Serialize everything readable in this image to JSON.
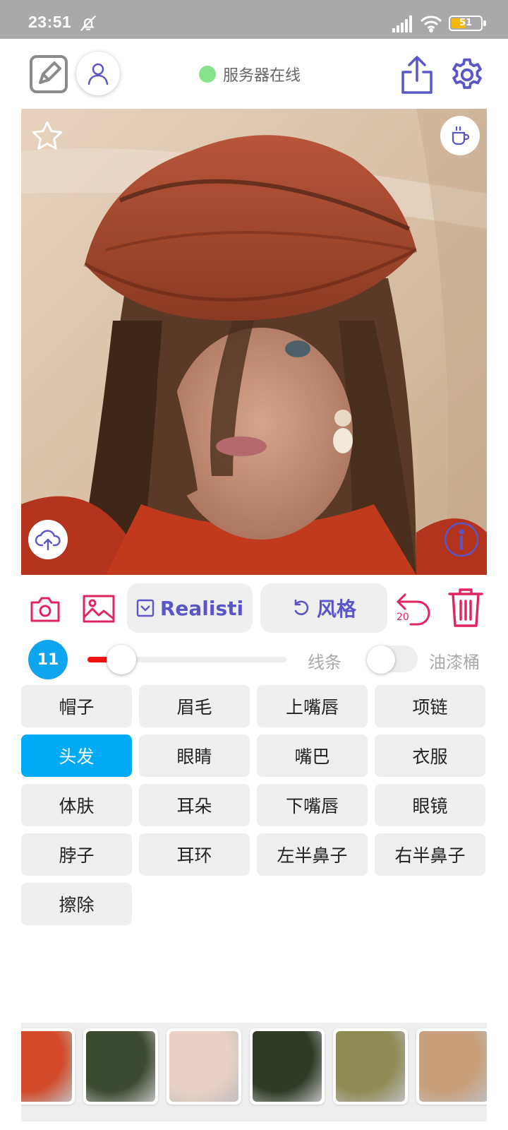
{
  "status_bar": {
    "time": "23:51",
    "battery": "51",
    "battery_level": 0.51,
    "icons": [
      "bell-off-icon",
      "signal-icon",
      "wifi-icon",
      "battery-icon"
    ]
  },
  "toolbar": {
    "server_status": "服务器在线",
    "server_status_color": "#86e38a",
    "icons": [
      "edit-icon",
      "user-icon",
      "share-icon",
      "settings-icon"
    ]
  },
  "canvas": {
    "icons": [
      "star-icon",
      "cup-icon",
      "cloud-upload-icon",
      "info-icon"
    ]
  },
  "actions": {
    "model_label": "Realisti",
    "style_label": "风格",
    "undo_count": "20",
    "accent_color": "#e0245e",
    "primary_color": "#5b56c8"
  },
  "brush": {
    "size": "11",
    "slider_level": 0.17,
    "lines_label": "线条",
    "bucket_label": "油漆桶",
    "bucket_enabled": false
  },
  "segments": {
    "active": "头发",
    "items": [
      "帽子",
      "眉毛",
      "上嘴唇",
      "项链",
      "头发",
      "眼睛",
      "嘴巴",
      "衣服",
      "体肤",
      "耳朵",
      "下嘴唇",
      "眼镜",
      "脖子",
      "耳环",
      "左半鼻子",
      "右半鼻子",
      "擦除"
    ]
  },
  "textures": [
    "#d24a2a",
    "#3d4a32",
    "#ead0c4",
    "#2e3a26",
    "#8e8b56",
    "#c9a07c"
  ]
}
